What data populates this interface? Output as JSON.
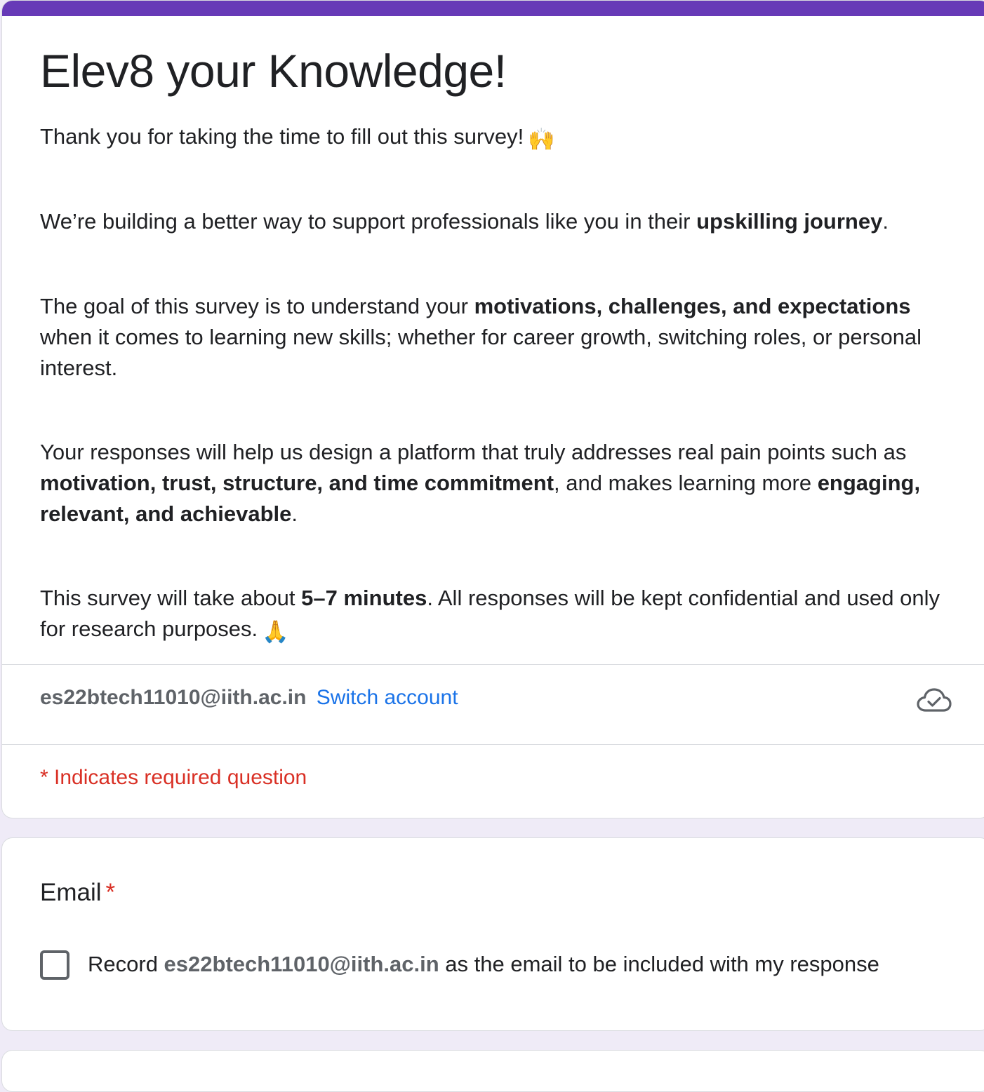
{
  "form": {
    "title": "Elev8 your Knowledge!",
    "intro": "Thank you for taking the time to fill out this survey!",
    "intro_emoji": "🙌",
    "p2_a": "We’re building a better way to support professionals like you in their ",
    "p2_b": "upskilling journey",
    "p2_c": ".",
    "p3_a": "The goal of this survey is to understand your ",
    "p3_b": "motivations, challenges, and expectations",
    "p3_c": " when it comes to learning new skills; whether for career growth, switching roles, or personal interest.",
    "p4_a": "Your responses will help us design a platform that truly addresses real pain points such as ",
    "p4_b": "motivation, trust, structure, and time commitment",
    "p4_c": ", and makes learning more ",
    "p4_d": "engaging, relevant, and achievable",
    "p4_e": ".",
    "p5_a": "This survey will take about ",
    "p5_b": "5–7 minutes",
    "p5_c": ". All responses will be kept confidential and used only for research purposes.",
    "p5_emoji": "🙏"
  },
  "account": {
    "email": "es22btech11010@iith.ac.in",
    "switch_label": "Switch account",
    "cloud_icon": "cloud-check-icon"
  },
  "required_note": "* Indicates required question",
  "email_question": {
    "title": "Email",
    "required_mark": "*",
    "checkbox_prefix": "Record ",
    "checkbox_email": "es22btech11010@iith.ac.in",
    "checkbox_suffix": " as the email to be included with my response",
    "checked": false
  },
  "colors": {
    "accent": "#673ab7",
    "background": "#efebf7",
    "link": "#1a73e8",
    "required": "#d93025"
  }
}
